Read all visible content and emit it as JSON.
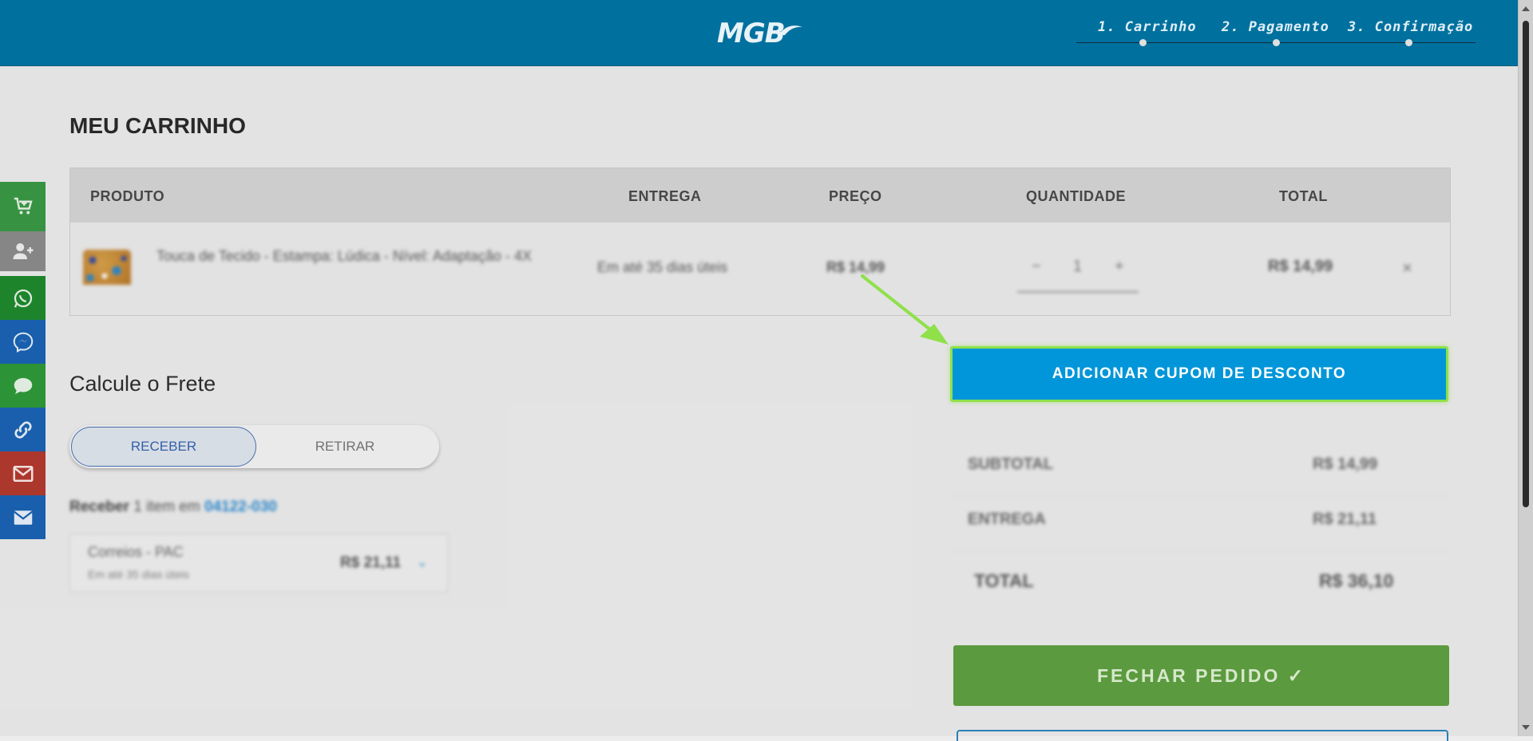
{
  "header": {
    "logo": "MGB",
    "steps": [
      {
        "label": "1. Carrinho"
      },
      {
        "label": "2. Pagamento"
      },
      {
        "label": "3. Confirmação"
      }
    ]
  },
  "sidebar": {
    "items": [
      {
        "name": "add-to-cart",
        "color": "#3a9a44"
      },
      {
        "name": "add-user",
        "color": "#8c8c8c"
      },
      {
        "name": "whatsapp",
        "color": "#1f8a2e"
      },
      {
        "name": "messenger",
        "color": "#1b63b5"
      },
      {
        "name": "chat",
        "color": "#2f9a3a"
      },
      {
        "name": "link",
        "color": "#1b63b5"
      },
      {
        "name": "email",
        "color": "#b33a2f"
      },
      {
        "name": "email-alt",
        "color": "#1b63b5"
      }
    ]
  },
  "page": {
    "title": "MEU CARRINHO"
  },
  "table": {
    "headers": {
      "produto": "PRODUTO",
      "entrega": "ENTREGA",
      "preco": "PREÇO",
      "quantidade": "QUANTIDADE",
      "total": "TOTAL"
    },
    "row": {
      "product_name": "Touca de Tecido - Estampa: Lúdica - Nível: Adaptação - 4X",
      "delivery": "Em até 35 dias úteis",
      "price": "R$ 14,99",
      "qty_minus": "−",
      "quantity": "1",
      "qty_plus": "+",
      "total": "R$ 14,99",
      "remove": "×"
    }
  },
  "frete": {
    "title": "Calcule o Frete",
    "option_receber": "RECEBER",
    "option_retirar": "RETIRAR",
    "receber_label": "Receber",
    "receber_text": "1 item em",
    "cep": "04122-030",
    "shipping_name": "Correios - PAC",
    "shipping_time": "Em até 35 dias úteis",
    "shipping_price": "R$ 21,11"
  },
  "coupon": {
    "label": "ADICIONAR CUPOM DE DESCONTO"
  },
  "summary": {
    "subtotal_label": "SUBTOTAL",
    "subtotal_value": "R$ 14,99",
    "entrega_label": "ENTREGA",
    "entrega_value": "R$ 21,11",
    "total_label": "TOTAL",
    "total_value": "R$ 36,10"
  },
  "checkout": {
    "label": "FECHAR PEDIDO ✓"
  }
}
